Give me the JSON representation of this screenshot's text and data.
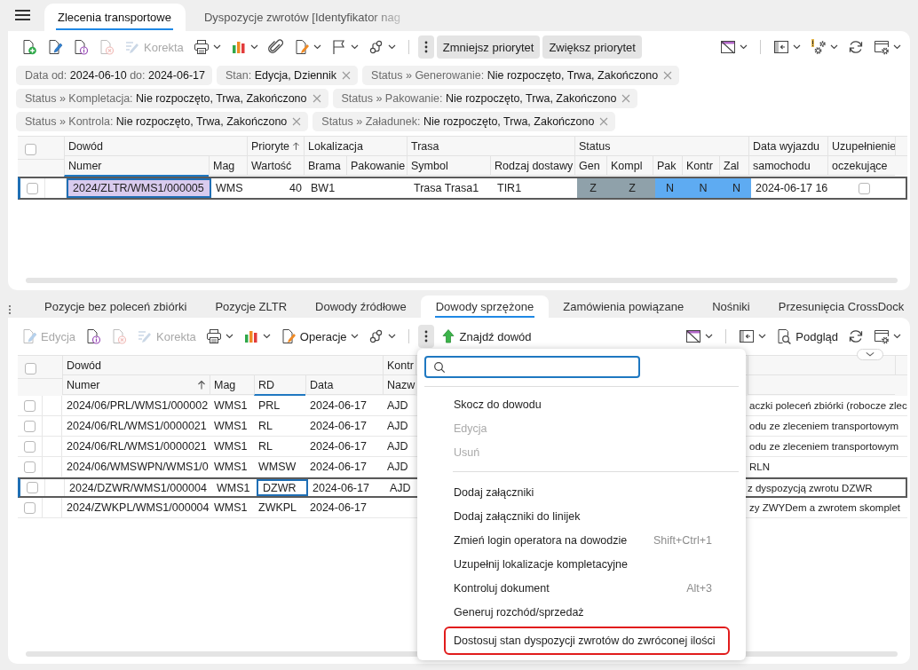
{
  "header_tabs": [
    {
      "label": "Zlecenia transportowe",
      "selected": true
    },
    {
      "label": "Dyspozycje zwrotów [Identyfikator nag",
      "selected": false
    }
  ],
  "top_panel": {
    "toolbar": {
      "left": [
        {
          "kind": "new",
          "disabled": false
        },
        {
          "kind": "edit",
          "disabled": false
        },
        {
          "kind": "info",
          "disabled": false
        },
        {
          "kind": "delete",
          "disabled": true
        },
        {
          "kind": "correction",
          "label": "Korekta",
          "disabled": true
        },
        {
          "kind": "print",
          "menu": true,
          "disabled": false
        },
        {
          "kind": "chart",
          "menu": true,
          "disabled": false
        },
        {
          "kind": "attach",
          "disabled": false
        },
        {
          "kind": "operations",
          "menu": true,
          "disabled": false
        },
        {
          "kind": "flag",
          "menu": true,
          "disabled": false
        },
        {
          "kind": "workflow",
          "menu": true,
          "disabled": false
        },
        {
          "kind": "separator"
        },
        {
          "kind": "more",
          "disabled": false
        },
        {
          "kind": "text",
          "label": "Zmniejsz priorytet",
          "disabled": false
        },
        {
          "kind": "text",
          "label": "Zwiększ priorytet",
          "disabled": false
        }
      ],
      "right": [
        {
          "kind": "filter",
          "menu": true,
          "disabled": false
        },
        {
          "kind": "separator"
        },
        {
          "kind": "panel",
          "menu": true,
          "disabled": false
        },
        {
          "kind": "alert_settings",
          "menu": true,
          "disabled": false
        },
        {
          "kind": "refresh",
          "disabled": false
        },
        {
          "kind": "view_settings",
          "menu": true,
          "disabled": false
        }
      ]
    },
    "filters": [
      {
        "text": "Data od: **2024-06-10** do: **2024-06-17**",
        "removable": false
      },
      {
        "text": "Stan: **Edycja, Dziennik**",
        "removable": true
      },
      {
        "text": "Status » Generowanie: **Nie rozpoczęto, Trwa, Zakończono**",
        "removable": true
      },
      {
        "text": "Status » Kompletacja: **Nie rozpoczęto, Trwa, Zakończono**",
        "removable": true
      },
      {
        "text": "Status » Pakowanie: **Nie rozpoczęto, Trwa, Zakończono**",
        "removable": true
      },
      {
        "text": "Status » Kontrola: **Nie rozpoczęto, Trwa, Zakończono**",
        "removable": true
      },
      {
        "text": "Status » Załadunek: **Nie rozpoczęto, Trwa, Zakończono**",
        "removable": true
      }
    ],
    "table": {
      "all_checked": false,
      "groups": [
        {
          "label": "Dowód",
          "columns": [
            {
              "label": "Numer",
              "active": true
            },
            {
              "label": "Mag",
              "active": false
            }
          ]
        },
        {
          "label": "Prioryte",
          "sort_ascending": true,
          "columns": [
            {
              "label": "Wartość",
              "kind": "number",
              "active": false
            }
          ]
        },
        {
          "label": "Lokalizacja",
          "columns": [
            {
              "label": "Brama",
              "active": false
            },
            {
              "label": "Pakowanie",
              "active": false
            }
          ]
        },
        {
          "label": "Trasa",
          "columns": [
            {
              "label": "Symbol",
              "active": false
            },
            {
              "label": "Rodzaj dostawy",
              "active": false
            }
          ]
        },
        {
          "label": "Status",
          "columns": [
            {
              "label": "Gen",
              "active": false
            },
            {
              "label": "Kompl",
              "active": false
            },
            {
              "label": "Pak",
              "active": false
            },
            {
              "label": "Kontr",
              "active": false
            },
            {
              "label": "Zal",
              "active": false
            }
          ]
        },
        {
          "label": "Data wyjazdu",
          "columns": [
            {
              "label": "samochodu",
              "active": false
            }
          ]
        },
        {
          "label": "Uzupełnienie",
          "columns": [
            {
              "label": "oczekujące",
              "kind": "checkbox",
              "active": false
            }
          ]
        }
      ],
      "rows": [
        {
          "selected": true,
          "checked": false,
          "cells": [
            {
              "text": "2024/ZLTR/WMS1/000005",
              "color": "#d9cbee",
              "focused": true
            },
            {
              "text": "WMS"
            },
            {
              "text": "40"
            },
            {
              "text": "BW1"
            },
            {},
            {
              "text": "Trasa Trasa1"
            },
            {
              "text": "TIR1"
            },
            {
              "text": "Z",
              "color": "#8fa1aa"
            },
            {
              "text": "Z",
              "color": "#8fa1aa"
            },
            {
              "text": "N",
              "color": "#5eabf2"
            },
            {
              "text": "N",
              "color": "#5eabf2"
            },
            {
              "text": "N",
              "color": "#5eabf2"
            },
            {
              "text": "2024-06-17 16"
            },
            {
              "checked": false
            }
          ]
        }
      ]
    }
  },
  "bottom_tabs": [
    {
      "label": "Pozycje bez poleceń zbiórki",
      "selected": false
    },
    {
      "label": "Pozycje ZLTR",
      "selected": false
    },
    {
      "label": "Dowody źródłowe",
      "selected": false
    },
    {
      "label": "Dowody sprzężone",
      "selected": true
    },
    {
      "label": "Zamówienia powiązane",
      "selected": false
    },
    {
      "label": "Nośniki",
      "selected": false
    },
    {
      "label": "Przesunięcia CrossDock",
      "selected": false
    }
  ],
  "bottom_panel": {
    "toolbar": {
      "left": [
        {
          "kind": "edit",
          "label": "Edycja",
          "disabled": true
        },
        {
          "kind": "info",
          "disabled": false
        },
        {
          "kind": "delete",
          "disabled": true
        },
        {
          "kind": "correction",
          "label": "Korekta",
          "disabled": true
        },
        {
          "kind": "print",
          "menu": true,
          "disabled": false
        },
        {
          "kind": "chart",
          "menu": true,
          "disabled": false
        },
        {
          "kind": "operations",
          "label": "Operacje",
          "menu": true,
          "disabled": false
        },
        {
          "kind": "workflow",
          "menu": true,
          "disabled": false
        },
        {
          "kind": "separator"
        },
        {
          "kind": "more",
          "disabled": false
        },
        {
          "kind": "find",
          "label": "Znajdź dowód",
          "disabled": false
        }
      ],
      "right": [
        {
          "kind": "filter",
          "menu": true,
          "disabled": false
        },
        {
          "kind": "separator"
        },
        {
          "kind": "panel",
          "menu": true,
          "disabled": false
        },
        {
          "kind": "preview",
          "label": "Podgląd",
          "disabled": false
        },
        {
          "kind": "refresh",
          "disabled": false
        },
        {
          "kind": "view_settings",
          "menu": true,
          "disabled": false
        }
      ]
    },
    "table": {
      "all_checked": false,
      "groups": [
        {
          "label": "Dowód",
          "columns": [
            {
              "label": "Numer",
              "sort_ascending": true,
              "active": false
            },
            {
              "label": "Mag",
              "active": false
            },
            {
              "label": "RD",
              "active": true
            },
            {
              "label": "Data",
              "active": false
            }
          ]
        },
        {
          "label": "Kontr",
          "columns": [
            {
              "label": "Nazw",
              "active": false
            }
          ]
        },
        {
          "columns": [
            {
              "active": false
            }
          ]
        }
      ],
      "rows": [
        {
          "selected": false,
          "checked": false,
          "cells": [
            {
              "text": "2024/06/PRL/WMS1/000002"
            },
            {
              "text": "WMS1"
            },
            {
              "text": "PRL"
            },
            {
              "text": "2024-06-17"
            },
            {
              "text": "AJD"
            },
            {
              "text": "aczki poleceń zbiórki (robocze zlec"
            }
          ]
        },
        {
          "selected": false,
          "checked": false,
          "cells": [
            {
              "text": "2024/06/RL/WMS1/0000021"
            },
            {
              "text": "WMS1"
            },
            {
              "text": "RL"
            },
            {
              "text": "2024-06-17"
            },
            {
              "text": "AJD"
            },
            {
              "text": "odu ze zleceniem transportowym"
            }
          ]
        },
        {
          "selected": false,
          "checked": false,
          "cells": [
            {
              "text": "2024/06/RL/WMS1/0000021"
            },
            {
              "text": "WMS1"
            },
            {
              "text": "RL"
            },
            {
              "text": "2024-06-17"
            },
            {
              "text": "AJD"
            },
            {
              "text": "odu ze zleceniem transportowym"
            }
          ]
        },
        {
          "selected": false,
          "checked": false,
          "cells": [
            {
              "text": "2024/06/WMSWPN/WMS1/0"
            },
            {
              "text": "WMS1"
            },
            {
              "text": "WMSW"
            },
            {
              "text": "2024-06-17"
            },
            {
              "text": "AJD"
            },
            {
              "text": "RLN"
            }
          ]
        },
        {
          "selected": true,
          "checked": false,
          "cells": [
            {
              "text": "2024/DZWR/WMS1/000004"
            },
            {
              "text": "WMS1"
            },
            {
              "text": "DZWR",
              "focused": true
            },
            {
              "text": "2024-06-17"
            },
            {
              "text": "AJD"
            },
            {
              "text": "z dyspozycją zwrotu DZWR"
            }
          ]
        },
        {
          "selected": false,
          "checked": false,
          "cells": [
            {
              "text": "2024/ZWKPL/WMS1/000004"
            },
            {
              "text": "WMS1"
            },
            {
              "text": "ZWKPL"
            },
            {
              "text": "2024-06-17"
            },
            {},
            {
              "text": "zy ZWYDem a zwrotem skomplet"
            }
          ]
        }
      ]
    },
    "context_menu": {
      "search": {
        "focused": true
      },
      "items": [
        {
          "kind": "separator"
        },
        {
          "kind": "item",
          "label": "Skocz do dowodu",
          "disabled": false,
          "highlighted": false
        },
        {
          "kind": "item",
          "label": "Edycja",
          "disabled": true,
          "highlighted": false
        },
        {
          "kind": "item",
          "label": "Usuń",
          "disabled": true,
          "highlighted": false
        },
        {
          "kind": "separator"
        },
        {
          "kind": "item",
          "label": "Dodaj załączniki",
          "disabled": false,
          "highlighted": false
        },
        {
          "kind": "item",
          "label": "Dodaj załączniki do linijek",
          "disabled": false,
          "highlighted": false
        },
        {
          "kind": "item",
          "label": "Zmień login operatora na dowodzie",
          "shortcut": "Shift+Ctrl+1",
          "disabled": false,
          "highlighted": false
        },
        {
          "kind": "item",
          "label": "Uzupełnij lokalizacje kompletacyjne",
          "disabled": false,
          "highlighted": false
        },
        {
          "kind": "item",
          "label": "Kontroluj dokument",
          "shortcut": "Alt+3",
          "disabled": false,
          "highlighted": false
        },
        {
          "kind": "item",
          "label": "Generuj rozchód/sprzedaż",
          "disabled": false,
          "highlighted": false
        },
        {
          "kind": "item",
          "label": "Dostosuj stan dyspozycji zwrotów do zwróconej ilości",
          "disabled": false,
          "highlighted": true
        }
      ]
    }
  }
}
